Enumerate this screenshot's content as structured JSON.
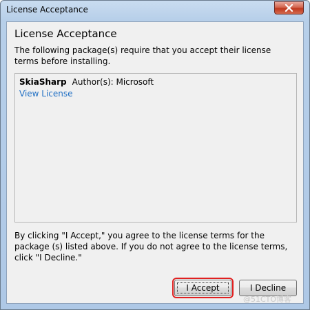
{
  "window": {
    "title": "License Acceptance",
    "close_icon": "close-icon"
  },
  "dialog": {
    "heading": "License Acceptance",
    "intro": "The following package(s) require that you accept their license terms before installing.",
    "packages": [
      {
        "name": "SkiaSharp",
        "author": "Author(s):  Microsoft",
        "link_label": "View License"
      }
    ],
    "footer": "By clicking \"I Accept,\" you agree to the license terms for the package (s) listed above. If you do not agree to the license terms, click \"I Decline.\""
  },
  "buttons": {
    "accept_label": "I Accept",
    "decline_label": "I Decline"
  },
  "watermark": "@51CTO博客",
  "colors": {
    "link": "#1f6fc4",
    "highlight": "#e02020"
  }
}
